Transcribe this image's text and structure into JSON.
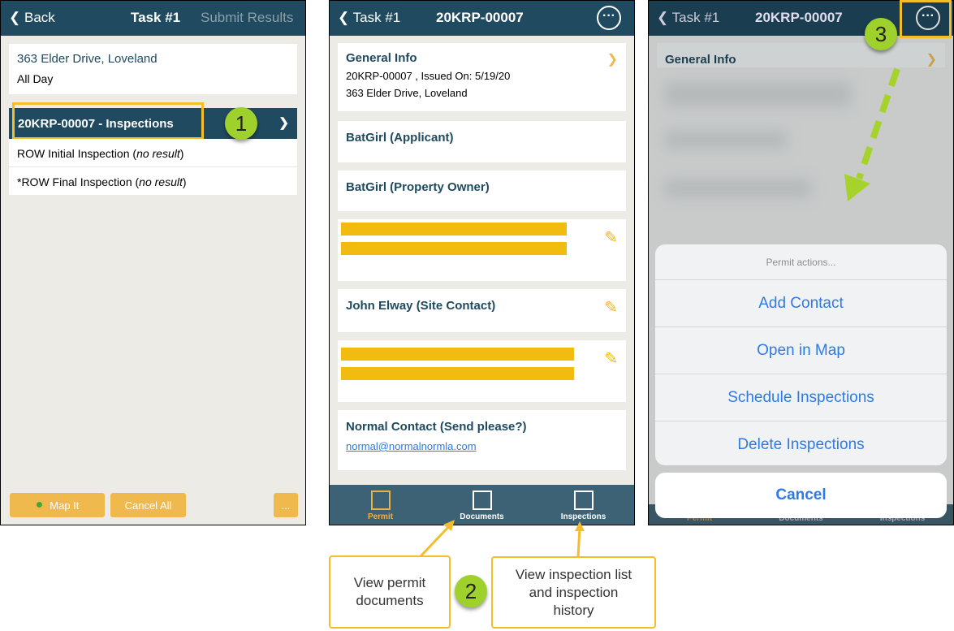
{
  "colors": {
    "header": "#1f4a5f",
    "accent": "#f0b94e",
    "callout_border": "#f4bd2a",
    "step_circle": "#9fd12c",
    "link": "#2f7ae5"
  },
  "screen1": {
    "back": "Back",
    "title": "Task #1",
    "submit": "Submit Results",
    "address": "363 Elder Drive, Loveland",
    "time": "All Day",
    "selected": "20KRP-00007 - Inspections",
    "rows": [
      {
        "name": "ROW Initial Inspection",
        "status": "no result"
      },
      {
        "name": "*ROW Final Inspection",
        "status": "no result"
      }
    ],
    "open_paren": "(",
    "close_paren": ")",
    "map_it": "Map It",
    "cancel_all": "Cancel All",
    "more": "..."
  },
  "screen2": {
    "back": "Task #1",
    "title": "20KRP-00007",
    "general_info": "General Info",
    "info_line1": "20KRP-00007 , Issued On: 5/19/20",
    "info_line2": "363 Elder Drive, Loveland",
    "contacts": [
      "BatGirl (Applicant)",
      "BatGirl (Property Owner)",
      "John Elway (Site Contact)",
      "Normal Contact (Send please?)"
    ],
    "email": "normal@normalnormla.com",
    "tabs": [
      "Permit",
      "Documents",
      "Inspections"
    ]
  },
  "screen3": {
    "back": "Task #1",
    "title": "20KRP-00007",
    "general_info": "General Info",
    "sheet_title": "Permit actions...",
    "actions": [
      "Add Contact",
      "Open in Map",
      "Schedule Inspections",
      "Delete Inspections"
    ],
    "cancel": "Cancel",
    "tabs": [
      "Permit",
      "Documents",
      "Inspections"
    ]
  },
  "annotations": {
    "step1": "1",
    "step2": "2",
    "step3": "3",
    "callout_documents": "View permit documents",
    "callout_inspections": "View inspection list and inspection history"
  }
}
